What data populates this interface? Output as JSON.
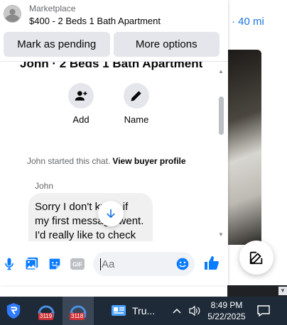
{
  "background": {
    "distance_text": "· 40 mi"
  },
  "header": {
    "subtitle": "Marketplace",
    "title": "$400 - 2 Beds 1 Bath Apartment"
  },
  "actions": {
    "mark_pending": "Mark as pending",
    "more_options": "More options"
  },
  "chat": {
    "partial_title": "John · 2 Beds 1 Bath Apartment",
    "quick_actions": [
      {
        "label": "Add",
        "icon": "add-person-icon"
      },
      {
        "label": "Name",
        "icon": "pencil-icon"
      }
    ],
    "started_text": "John started this chat.",
    "view_profile": "View buyer profile",
    "sender": "John",
    "message_lines": [
      "Sorry I don't know if",
      "my first message went.",
      "I'd really like to check"
    ]
  },
  "composer": {
    "placeholder": "Aa",
    "icons": [
      "microphone-icon",
      "photo-icon",
      "sticker-icon",
      "gif-icon",
      "emoji-icon",
      "like-icon"
    ]
  },
  "taskbar": {
    "apps": [
      {
        "name": "shield-app-icon"
      },
      {
        "name": "headset-app-icon",
        "badge": "3119"
      },
      {
        "name": "headset-app-icon",
        "badge": "3118"
      },
      {
        "name": "id-card-app-icon",
        "label": "Tru..."
      }
    ],
    "time": "8:49 PM",
    "date": "5/22/2025"
  },
  "colors": {
    "accent": "#1b74e4",
    "like": "#0a7cff",
    "taskbar": "#1f2a38"
  }
}
